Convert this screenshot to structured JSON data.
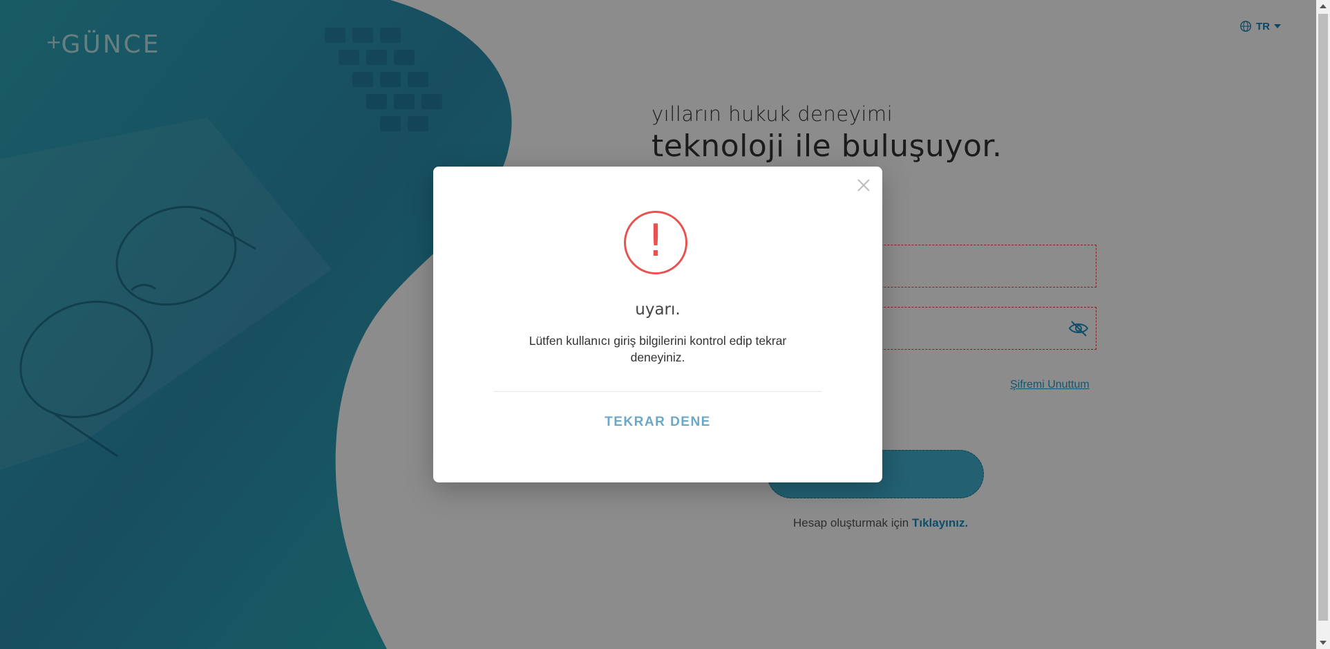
{
  "brand": {
    "logo_text": "GÜNCE",
    "logo_plus": "+"
  },
  "language": {
    "current": "TR"
  },
  "headline": {
    "line1": "yılların hukuk deneyimi",
    "line2": "teknoloji ile buluşuyor."
  },
  "login": {
    "forgot_password": "Şifremi Unuttum",
    "signup_prefix": "Hesap oluşturmak için ",
    "signup_link": "Tıklayınız.",
    "submit_label": "?"
  },
  "modal": {
    "title": "uyarı.",
    "message": "Lütfen kullanıcı giriş bilgilerini kontrol edip tekrar deneyiniz.",
    "retry_button": "TEKRAR DENE",
    "icon_symbol": "!"
  },
  "colors": {
    "brand_teal": "#2aa6bd",
    "warning_red": "#e8534f",
    "link_blue": "#1b8fc0"
  }
}
